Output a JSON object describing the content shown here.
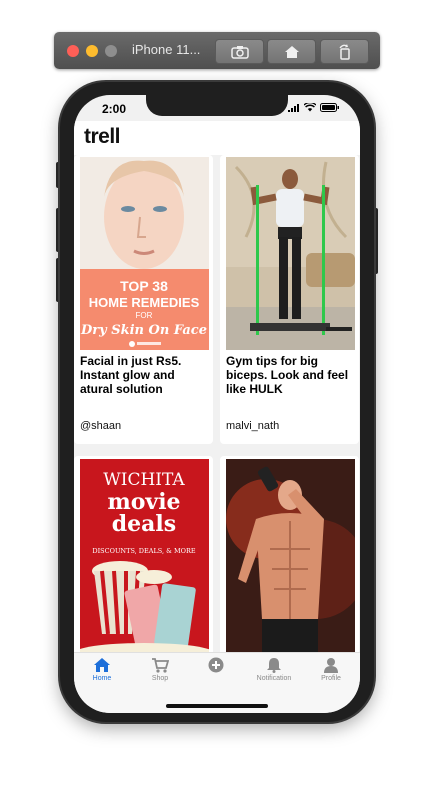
{
  "simulator": {
    "title": "iPhone 11..."
  },
  "status": {
    "time": "2:00"
  },
  "app": {
    "logo": "trell"
  },
  "posts": [
    {
      "title": "Facial in just Rs5. Instant glow and atural solution",
      "user": "@shaan",
      "thumb_lines": [
        "TOP 38",
        "HOME REMEDIES",
        "FOR",
        "Dry Skin On Face"
      ]
    },
    {
      "title": "Gym tips for big biceps. Look and feel like HULK",
      "user": "malvi_nath"
    },
    {
      "title": "",
      "user": "",
      "thumb_lines": [
        "WICHITA",
        "movie",
        "deals",
        "DISCOUNTS, DEALS, & MORE"
      ]
    },
    {
      "title": "",
      "user": ""
    }
  ],
  "tabs": [
    {
      "label": "Home",
      "icon": "home-icon",
      "active": true
    },
    {
      "label": "Shop",
      "icon": "cart-icon"
    },
    {
      "label": "",
      "icon": "plus-circle-icon"
    },
    {
      "label": "Notification",
      "icon": "bell-icon"
    },
    {
      "label": "Profile",
      "icon": "person-icon"
    }
  ],
  "colors": {
    "accent": "#1e6fd9",
    "salmon": "#f58b6e",
    "movie_red": "#c8161d"
  }
}
